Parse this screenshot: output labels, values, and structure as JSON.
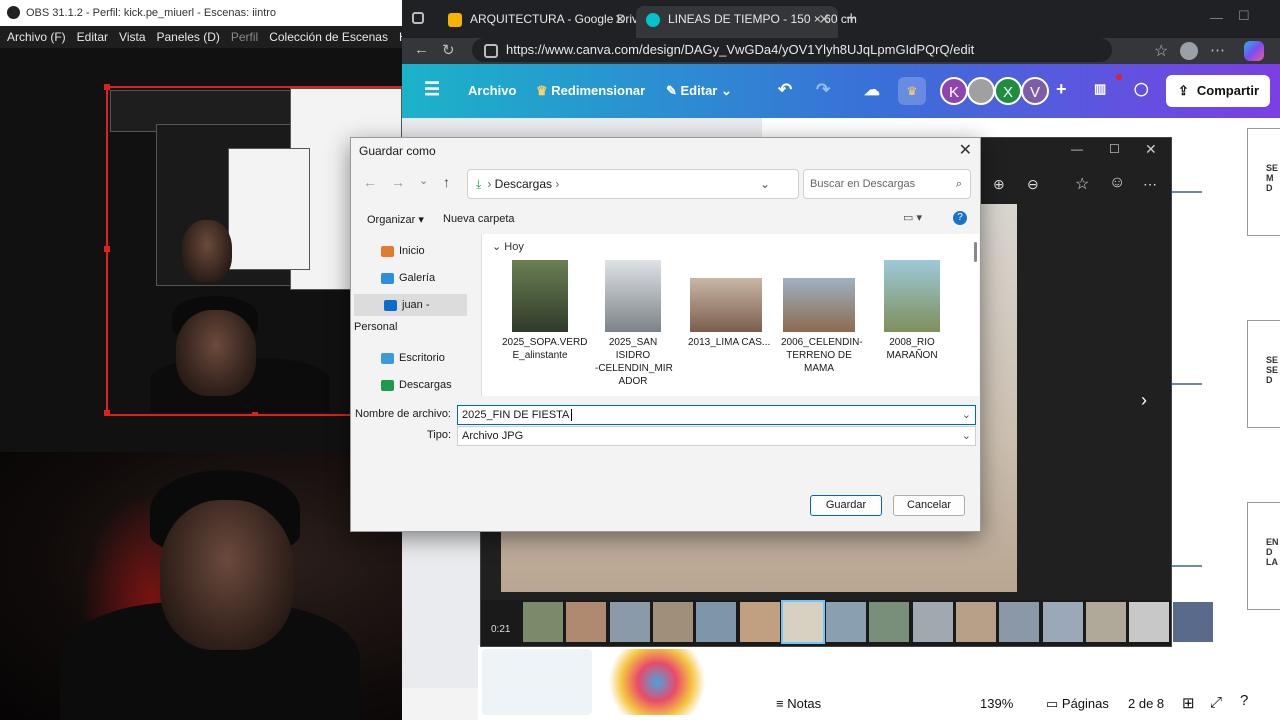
{
  "obs": {
    "title": "OBS 31.1.2 - Perfil: kick.pe_miuerl - Escenas: iintro",
    "menu": [
      "Archivo (F)",
      "Editar",
      "Vista",
      "Paneles (D)",
      "Perfil",
      "Colección de Escenas",
      "Herr"
    ]
  },
  "browser": {
    "tabs": [
      {
        "label": "ARQUITECTURA - Google Drive",
        "icon": "google-drive-icon",
        "color": "#f6b400"
      },
      {
        "label": "LINEAS DE TIEMPO - 150 × 60 cm",
        "icon": "canva-icon",
        "color": "#00c4cc"
      }
    ],
    "url": "https://www.canva.com/design/DAGy_VwGDa4/yOV1Ylyh8UJqLpmGIdPQrQ/edit"
  },
  "canva": {
    "menu": {
      "archivo": "Archivo",
      "redimensionar": "Redimensionar",
      "editar": "Editar"
    },
    "avatars": [
      {
        "letter": "K",
        "color": "#8e44ad"
      },
      {
        "letter": "",
        "color": "#a0a0a0"
      },
      {
        "letter": "X",
        "color": "#1e8e3e"
      },
      {
        "letter": "V",
        "color": "#7b5ea7"
      }
    ],
    "share_label": "Compartir",
    "design_boxes": [
      {
        "text": "SE\nM\nD"
      },
      {
        "text": "SE\nSE\nD"
      },
      {
        "text": "EN\nD\nLA"
      }
    ],
    "bottom": {
      "notes": "Notas",
      "zoom": "139%",
      "pages": "Páginas",
      "page_of": "2 de 8"
    }
  },
  "photos": {
    "timecode": "0:21"
  },
  "dialog": {
    "title": "Guardar como",
    "path": [
      "Descargas"
    ],
    "search_placeholder": "Buscar en Descargas",
    "organize_label": "Organizar",
    "new_folder_label": "Nueva carpeta",
    "nav": [
      {
        "label": "Inicio",
        "icon": "home-icon",
        "color": "#e07b2f",
        "selected": false
      },
      {
        "label": "Galería",
        "icon": "gallery-icon",
        "color": "#2d8fdb",
        "selected": false
      },
      {
        "label": "juan - Personal",
        "icon": "onedrive-icon",
        "color": "#0b6cc9",
        "selected": true
      },
      {
        "label": "Escritorio",
        "icon": "desktop-icon",
        "color": "#3a9bd9",
        "selected": false
      },
      {
        "label": "Descargas",
        "icon": "download-icon",
        "color": "#1f9a4c",
        "selected": false
      }
    ],
    "group_label": "Hoy",
    "files": [
      {
        "name": "2025_SOPA.VERD\nE_alinstante",
        "c1": "#6b7f54",
        "c2": "#2f3b2a",
        "wide": false
      },
      {
        "name": "2025_SAN\nISIDRO\n-CELENDIN_MIR\nADOR",
        "c1": "#dfe3e6",
        "c2": "#7c8288",
        "wide": false
      },
      {
        "name": "2013_LIMA CAS...",
        "c1": "#c9b7a6",
        "c2": "#7b5d4d",
        "wide": true
      },
      {
        "name": "2006_CELENDIN-\nTERRENO DE\nMAMA",
        "c1": "#9fb1c4",
        "c2": "#8c6b4d",
        "wide": true
      },
      {
        "name": "2008_RIO\nMARAÑON",
        "c1": "#9ec9d8",
        "c2": "#7f8f5c",
        "wide": false
      }
    ],
    "filename_label": "Nombre de archivo:",
    "filename_value": "2025_FIN DE FIESTA",
    "type_label": "Tipo:",
    "type_value": "Archivo JPG",
    "save_label": "Guardar",
    "cancel_label": "Cancelar"
  }
}
